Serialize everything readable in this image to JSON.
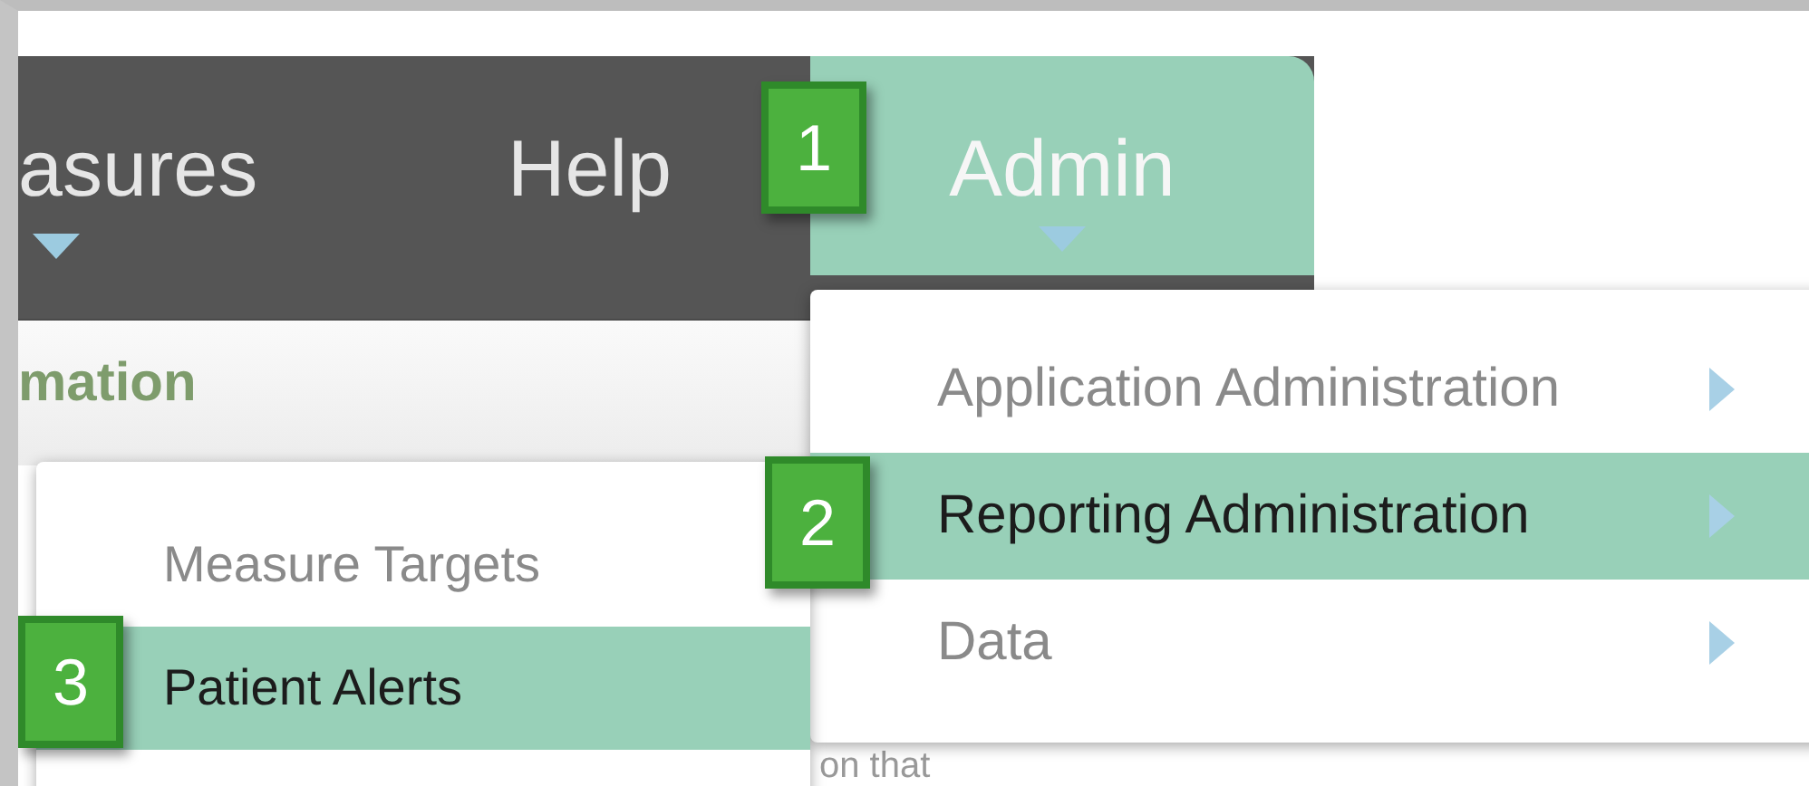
{
  "nav": {
    "items": [
      {
        "label": "asures",
        "selected": false,
        "caret": true
      },
      {
        "label": "Help",
        "selected": false,
        "caret": false
      },
      {
        "label": "Admin",
        "selected": true,
        "caret": true
      }
    ]
  },
  "section_heading": "mation",
  "admin_menu": {
    "items": [
      {
        "label": "Application Administration",
        "selected": false,
        "submenu": true
      },
      {
        "label": "Reporting Administration",
        "selected": true,
        "submenu": true
      },
      {
        "label": "Data",
        "selected": false,
        "submenu": true
      }
    ]
  },
  "submenu": {
    "items": [
      {
        "label": "Measure Targets",
        "selected": false
      },
      {
        "label": "Patient Alerts",
        "selected": true
      }
    ]
  },
  "body_text": "on that",
  "callouts": [
    "1",
    "2",
    "3"
  ]
}
